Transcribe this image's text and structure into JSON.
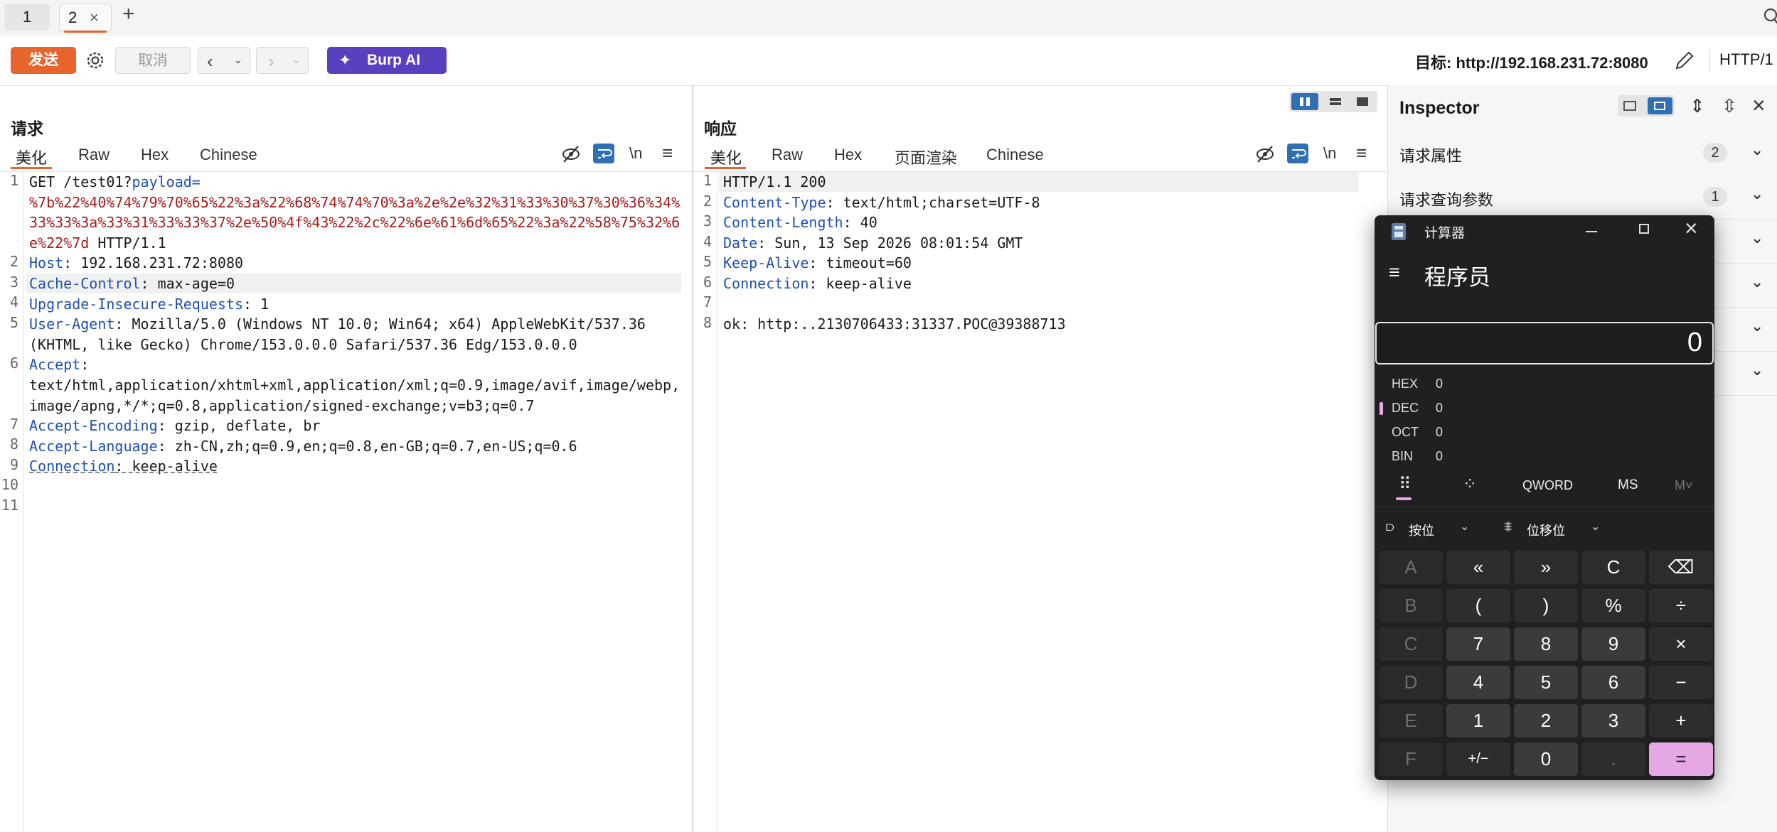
{
  "tabs": [
    {
      "label": "1"
    },
    {
      "label": "2",
      "close": "×"
    }
  ],
  "add_tab": "+",
  "toolbar": {
    "send": "发送",
    "cancel": "取消",
    "burp_ai": "Burp AI",
    "target": "目标: http://192.168.231.72:8080",
    "http_version": "HTTP/1"
  },
  "request": {
    "title": "请求",
    "tabs": [
      "美化",
      "Raw",
      "Hex",
      "Chinese"
    ],
    "newline_toggle": "\\n",
    "line_numbers": [
      "1",
      "2",
      "3",
      "4",
      "5",
      "6",
      "7",
      "8",
      "9",
      "10",
      "11"
    ],
    "lines": {
      "l1_method": "GET /test01?",
      "l1_param": "payload=",
      "l1_value_a": "%7b%22%40%74%79%70%65%22%3a%22%68%74%74%70%3a%2e%2e%32%31%33%30%37%30%36%34%",
      "l1_value_b": "33%33%3a%33%31%33%33%37%2e%50%4f%43%22%2c%22%6e%61%6d%65%22%3a%22%58%75%32%6",
      "l1_value_c": "e%22%7d",
      "l1_proto": " HTTP/1.1",
      "host_k": "Host",
      "host_v": ": 192.168.231.72:8080",
      "cc_k": "Cache-Control",
      "cc_v": ": max-age=0",
      "uir_k": "Upgrade-Insecure-Requests",
      "uir_v": ": 1",
      "ua_k": "User-Agent",
      "ua_v": ": Mozilla/5.0 (Windows NT 10.0; Win64; x64) AppleWebKit/537.36",
      "ua_v2": "(KHTML, like Gecko) Chrome/153.0.0.0 Safari/537.36 Edg/153.0.0.0",
      "acc_k": "Accept",
      "acc_v": ":",
      "acc_v2": "text/html,application/xhtml+xml,application/xml;q=0.9,image/avif,image/webp,",
      "acc_v3": "image/apng,*/*;q=0.8,application/signed-exchange;v=b3;q=0.7",
      "ae_k": "Accept-Encoding",
      "ae_v": ": gzip, deflate, br",
      "al_k": "Accept-Language",
      "al_v": ": zh-CN,zh;q=0.9,en;q=0.8,en-GB;q=0.7,en-US;q=0.6",
      "conn_k": "Connection",
      "conn_v": ": keep-alive"
    }
  },
  "response": {
    "title": "响应",
    "tabs": [
      "美化",
      "Raw",
      "Hex",
      "页面渲染",
      "Chinese"
    ],
    "newline_toggle": "\\n",
    "line_numbers": [
      "1",
      "2",
      "3",
      "4",
      "5",
      "6",
      "7",
      "8"
    ],
    "lines": {
      "status": "HTTP/1.1 200",
      "ct_k": "Content-Type",
      "ct_v": ": text/html;charset=UTF-8",
      "cl_k": "Content-Length",
      "cl_v": ": 40",
      "date_k": "Date",
      "date_v": ": Sun, 13 Sep 2026 08:01:54 GMT",
      "ka_k": "Keep-Alive",
      "ka_v": ": timeout=60",
      "conn_k": "Connection",
      "conn_v": ": keep-alive",
      "body": "ok: http:..2130706433:31337.POC@39388713"
    }
  },
  "inspector": {
    "title": "Inspector",
    "rows": [
      {
        "label": "请求属性",
        "count": "2"
      },
      {
        "label": "请求查询参数",
        "count": "1"
      }
    ]
  },
  "calculator": {
    "title": "计算器",
    "mode": "程序员",
    "display": "0",
    "radix": [
      {
        "name": "HEX",
        "value": "0"
      },
      {
        "name": "DEC",
        "value": "0"
      },
      {
        "name": "OCT",
        "value": "0"
      },
      {
        "name": "BIN",
        "value": "0"
      }
    ],
    "word_size": "QWORD",
    "memory": "MS",
    "memory_list": "M˅",
    "bitwise": "按位",
    "bitshift": "位移位",
    "keys": [
      [
        "A",
        "«",
        "»",
        "C",
        "⌫"
      ],
      [
        "B",
        "(",
        ")",
        "%",
        "÷"
      ],
      [
        "C",
        "7",
        "8",
        "9",
        "×"
      ],
      [
        "D",
        "4",
        "5",
        "6",
        "−"
      ],
      [
        "E",
        "1",
        "2",
        "3",
        "+"
      ],
      [
        "F",
        "+/−",
        "0",
        ".",
        "="
      ]
    ]
  },
  "colors": {
    "accent": "#e8642c",
    "burp_ai": "#5a3fc0",
    "header_key": "#1f4fb0",
    "param_value": "#a61c1c",
    "calc_equals": "#e5a8e4"
  }
}
